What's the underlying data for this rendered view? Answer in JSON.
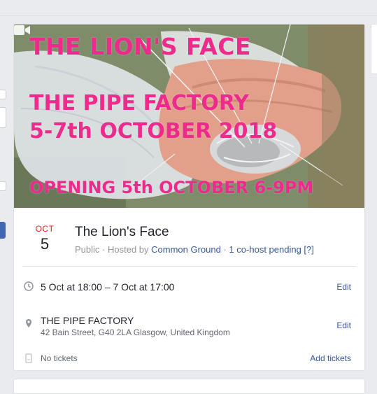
{
  "cover": {
    "line1": "THE LION'S FACE",
    "line2": "THE PIPE FACTORY",
    "line3": "5-7th OCTOBER 2018",
    "line4": "OPENING 5th OCTOBER 6-9PM",
    "video_icon": "video-camera-icon",
    "text_color": "#ec2b8c"
  },
  "event": {
    "month": "OCT",
    "day": "5",
    "title": "The Lion's Face",
    "privacy": "Public",
    "hosted_by_prefix": "· Hosted by",
    "host": "Common Ground",
    "cohost_separator": "·",
    "cohost_pending": "1 co-host pending [?]"
  },
  "details": {
    "time": {
      "icon": "clock-icon",
      "text": "5 Oct at 18:00 – 7 Oct at 17:00",
      "action": "Edit"
    },
    "location": {
      "icon": "map-pin-icon",
      "name": "THE PIPE FACTORY",
      "address": "42 Bain Street, G40 2LA Glasgow, United Kingdom",
      "action": "Edit"
    },
    "tickets": {
      "icon": "ticket-icon",
      "text": "No tickets",
      "action": "Add tickets"
    }
  },
  "colors": {
    "link": "#385898",
    "month": "#e41e1e",
    "accent_blue": "#4267b2"
  }
}
